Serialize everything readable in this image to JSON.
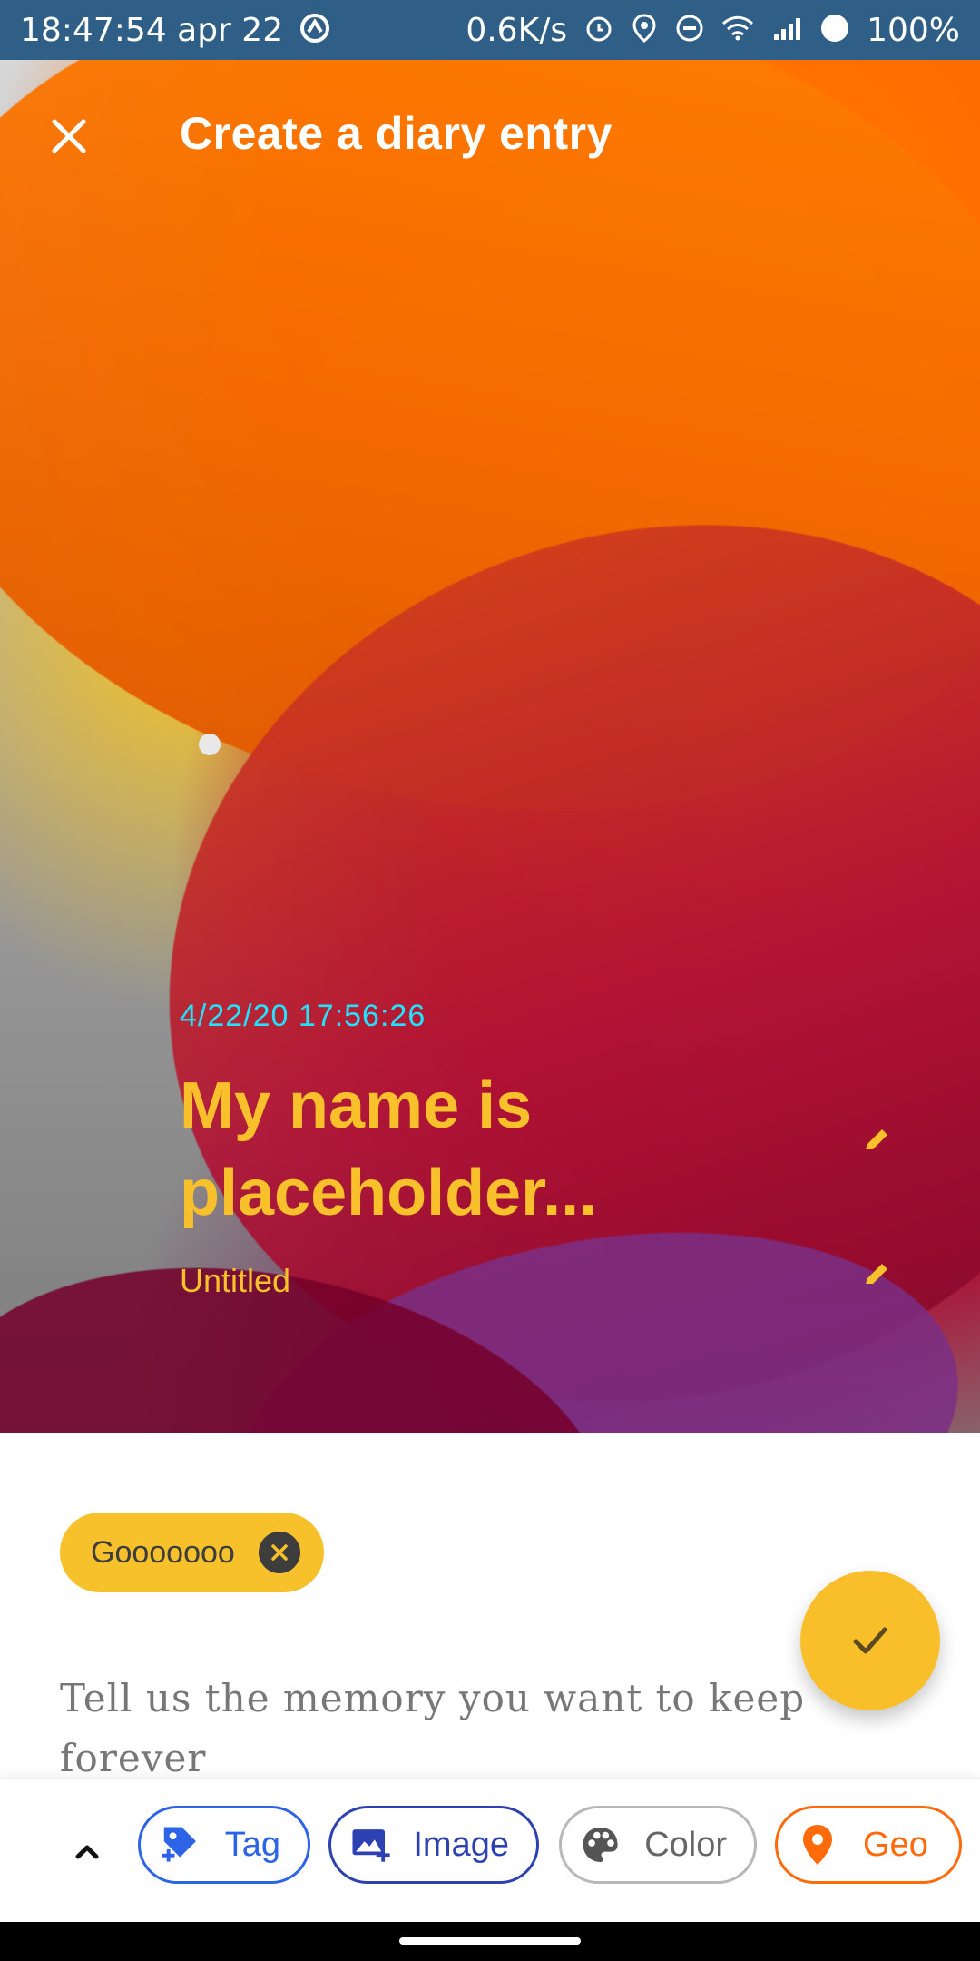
{
  "status_bar": {
    "time_date": "18:47:54 apr 22",
    "speed": "0.6K/s",
    "battery": "100%"
  },
  "appbar": {
    "title": "Create a diary entry"
  },
  "entry": {
    "timestamp": "4/22/20 17:56:26",
    "title": "My name is placeholder...",
    "subtitle": "Untitled"
  },
  "tags": [
    {
      "label": "Gooooooo"
    }
  ],
  "memory_placeholder": "Tell us the memory you want to keep forever",
  "toolbar": {
    "tag_label": "Tag",
    "image_label": "Image",
    "color_label": "Color",
    "geo_label": "Geo"
  },
  "colors": {
    "status_bar": "#2f5f86",
    "accent_yellow": "#f8c02b",
    "timestamp_cyan": "#22e3ff",
    "tag_blue": "#2d63e7",
    "image_blue": "#2d41b3",
    "geo_orange": "#ff6a0a"
  },
  "icons": {
    "close": "close-icon",
    "edit": "pencil-icon",
    "check": "check-icon",
    "expand": "chevron-up-icon",
    "tag": "tag-add-icon",
    "image": "image-add-icon",
    "color": "palette-icon",
    "geo": "location-pin-icon"
  }
}
